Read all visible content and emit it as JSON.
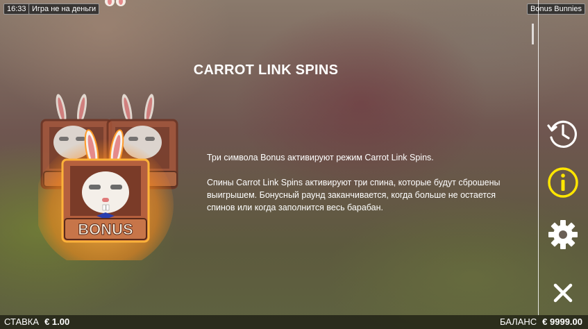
{
  "status": {
    "time": "16:33",
    "mode": "Игра не на деньги",
    "game_name": "Bonus Bunnies"
  },
  "rules": {
    "heading": "CARROT LINK SPINS",
    "paragraphs": [
      "Три символа Bonus активируют режим Carrot Link Spins.",
      "Спины Carrot Link Spins активируют три спина, которые будут сброшены выигрышем. Бонусный раунд заканчивается, когда больше не остается спинов или когда заполнится весь барабан."
    ],
    "symbol_label": "BONUS"
  },
  "sidebar": {
    "history_icon": "history-clock-icon",
    "info_icon": "info-icon",
    "settings_icon": "gear-icon",
    "close_icon": "close-icon",
    "info_color": "#ffe600"
  },
  "footer": {
    "bet_label": "СТАВКА",
    "bet_value": "€ 1.00",
    "balance_label": "БАЛАНС",
    "balance_value": "€ 9999.00"
  }
}
